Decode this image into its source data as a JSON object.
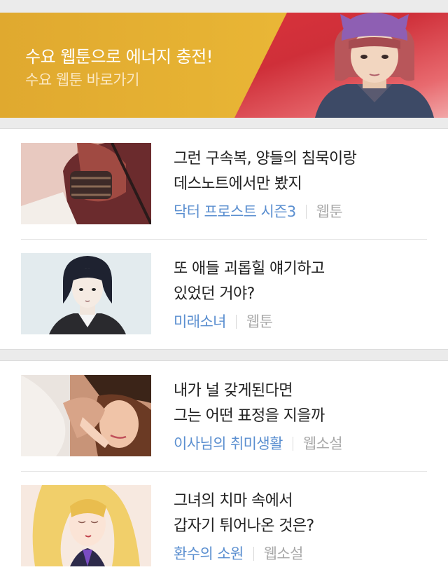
{
  "banner": {
    "title": "수요 웹툰으로 에너지 충전!",
    "subtitle": "수요 웹툰 바로가기"
  },
  "sections": [
    {
      "items": [
        {
          "line1": "그런 구속복, 양들의 침묵이랑",
          "line2": "데스노트에서만 봤지",
          "series": "닥터 프로스트 시즌3",
          "type": "웹툰"
        },
        {
          "line1": "또 애들 괴롭힐 얘기하고",
          "line2": "있었던 거야?",
          "series": "미래소녀",
          "type": "웹툰"
        }
      ]
    },
    {
      "items": [
        {
          "line1": "내가 널 갖게된다면",
          "line2": "그는 어떤 표정을 지을까",
          "series": "이사님의 취미생활",
          "type": "웹소설"
        },
        {
          "line1": "그녀의 치마 속에서",
          "line2": "갑자기 튀어나온 것은?",
          "series": "환수의 소원",
          "type": "웹소설"
        }
      ]
    }
  ],
  "colors": {
    "series_link": "#5b8fd0",
    "type_label": "#a8a8a8",
    "banner_gold": "#e6b233",
    "banner_red": "#d9333b"
  }
}
